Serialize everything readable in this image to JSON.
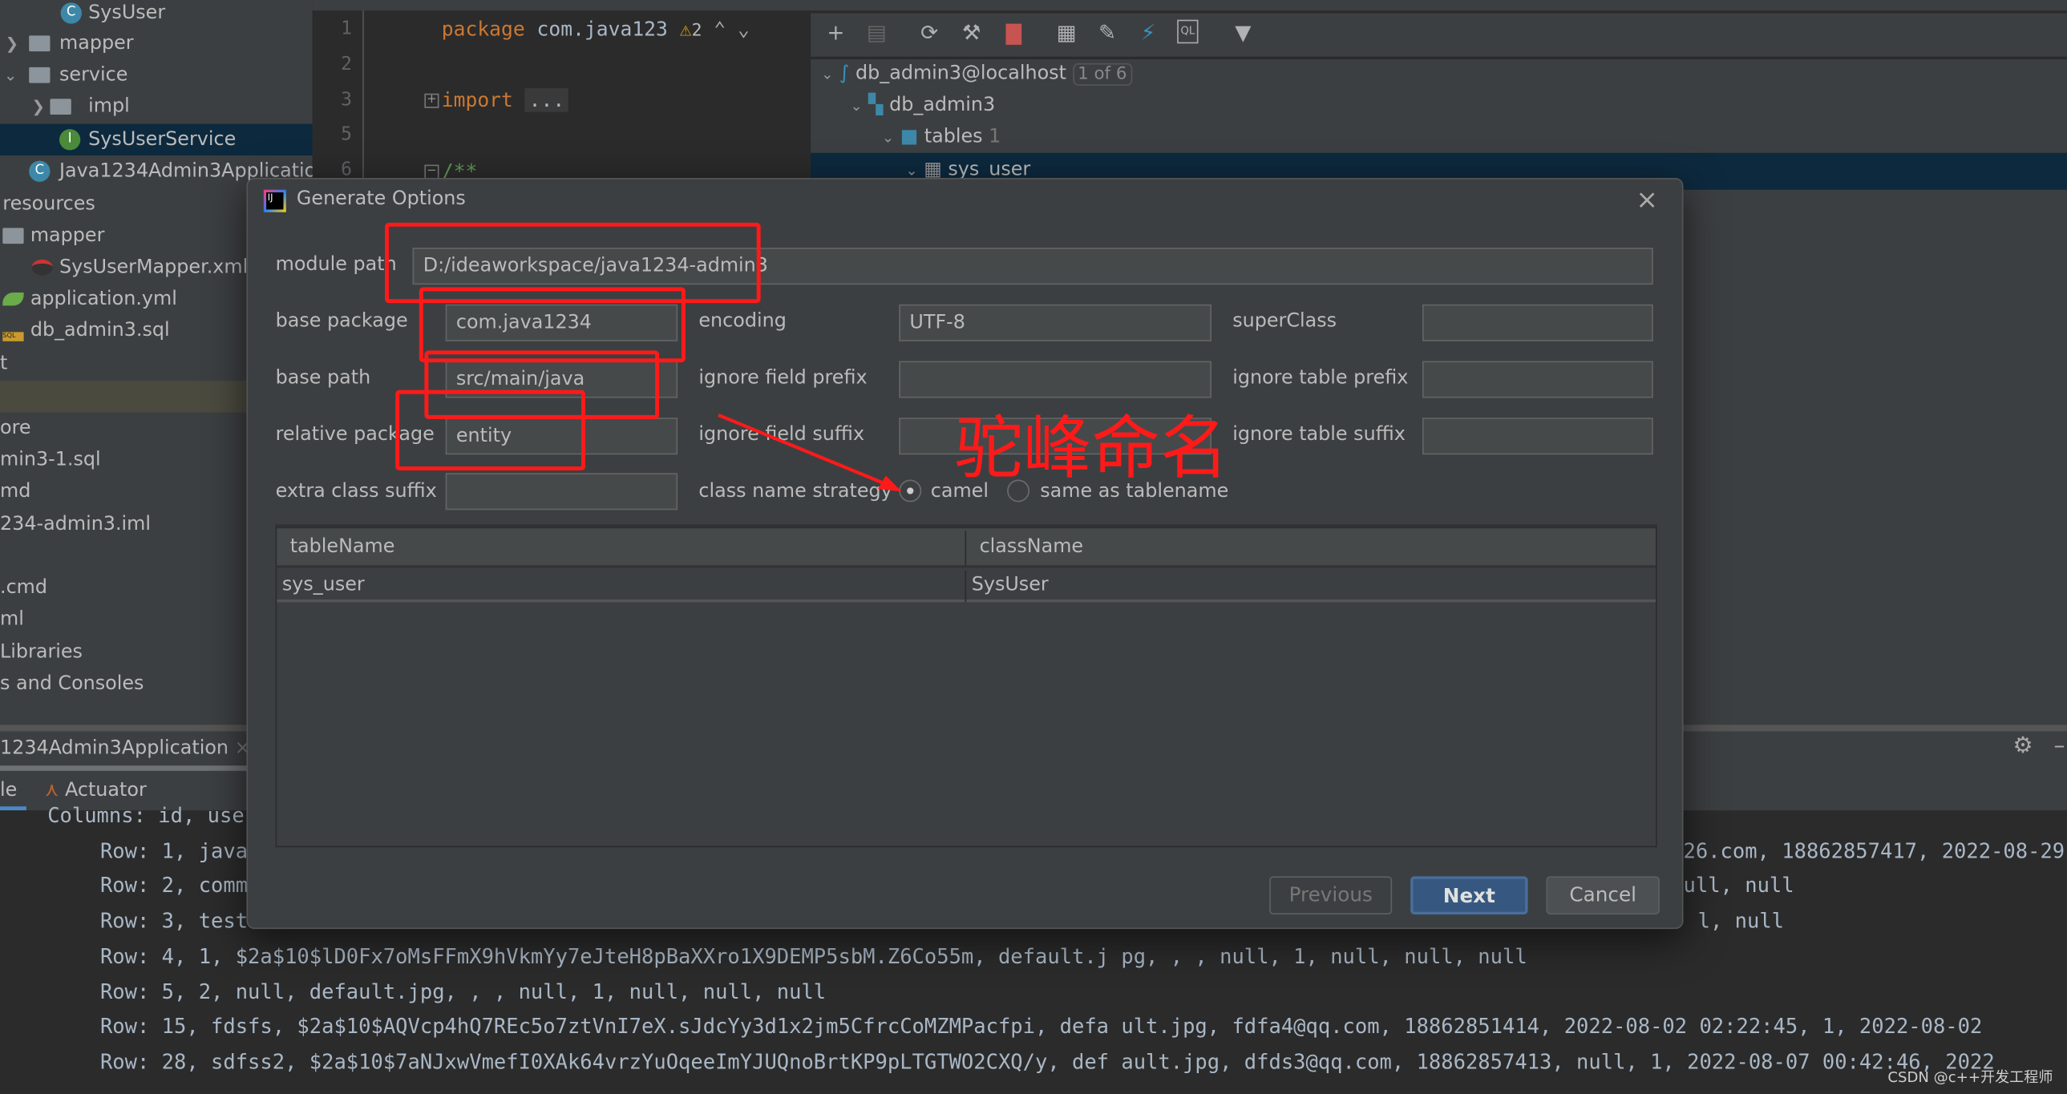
{
  "project_tree": {
    "items": [
      {
        "label": "SysUser",
        "icon": "class-icon"
      },
      {
        "label": "mapper",
        "icon": "package-icon"
      },
      {
        "label": "service",
        "icon": "package-icon"
      },
      {
        "label": "impl",
        "icon": "package-icon"
      },
      {
        "label": "SysUserService",
        "icon": "interface-icon"
      },
      {
        "label": "Java1234Admin3Application",
        "icon": "spring-boot-class-icon"
      },
      {
        "label": "resources",
        "icon": "folder-icon"
      },
      {
        "label": "mapper",
        "icon": "folder-icon"
      },
      {
        "label": "SysUserMapper.xml",
        "icon": "mybatis-icon"
      },
      {
        "label": "application.yml",
        "icon": "spring-config-icon"
      },
      {
        "label": "db_admin3.sql",
        "icon": "sql-icon"
      },
      {
        "label": "t"
      },
      {
        "label": ""
      },
      {
        "label": "ore"
      },
      {
        "label": "min3-1.sql"
      },
      {
        "label": "md"
      },
      {
        "label": "234-admin3.iml"
      },
      {
        "label": ""
      },
      {
        "label": ".cmd"
      },
      {
        "label": "ml"
      },
      {
        "label": "Libraries"
      },
      {
        "label": "s and Consoles"
      }
    ]
  },
  "editor": {
    "line_numbers": [
      "1",
      "2",
      "3",
      "5",
      "6"
    ],
    "line1_keyword": "package",
    "line1_text": "com.java123",
    "warning_count": "2",
    "line3_keyword": "import",
    "line3_folded": "...",
    "line6_text": "/**"
  },
  "database": {
    "connection": "db_admin3@localhost",
    "connection_badge": "1 of 6",
    "schema": "db_admin3",
    "tables_label": "tables",
    "tables_count": "1",
    "table": "sys_user"
  },
  "run_panel": {
    "run_tab": "1234Admin3Application",
    "tab_console": "le",
    "tab_actuator": "Actuator"
  },
  "console": {
    "lines": [
      "Columns: id, use",
      "Row: 1, java",
      "Row: 2, comm",
      "Row: 3, test",
      "Row: 4, 1, $2a$10$lD0Fx7oMsFFmX9hVkmYy7eJteH8pBaXXro1X9DEMP5sbM.Z6Co55m, default.j pg, , , null, 1, null, null, null",
      "Row: 5, 2, null, default.jpg, , , null, 1, null, null, null",
      "Row: 15, fdsfs, $2a$10$AQVcp4hQ7REc5o7ztVnI7eX.sJdcYy3d1x2jm5CfrcCoMZMPacfpi, defa ult.jpg, fdfa4@qq.com, 18862851414, 2022-08-02 02:22:45, 1, 2022-08-02",
      "Row: 28, sdfss2, $2a$10$7aNJxwVmefI0XAk64vrzYuOqeeImYJUQnoBrtKP9pLTGTWO2CXQ/y, def ault.jpg, dfds3@qq.com, 18862857413, null, 1, 2022-08-07 00:42:46, 2022"
    ],
    "row1_tail": "26.com, 18862857417, 2022-08-29",
    "row2_tail": "ull, null",
    "row3_tail": "l, null"
  },
  "dialog": {
    "title": "Generate Options",
    "module_path_label": "module path",
    "module_path": "D:/ideaworkspace/java1234-admin3",
    "base_package_label": "base package",
    "base_package": "com.java1234",
    "encoding_label": "encoding",
    "encoding": "UTF-8",
    "superclass_label": "superClass",
    "superclass": "",
    "base_path_label": "base path",
    "base_path": "src/main/java",
    "ignore_field_prefix_label": "ignore field prefix",
    "ignore_field_prefix": "",
    "ignore_table_prefix_label": "ignore table prefix",
    "ignore_table_prefix": "",
    "relative_package_label": "relative package",
    "relative_package": "entity",
    "ignore_field_suffix_label": "ignore field suffix",
    "ignore_field_suffix": "",
    "ignore_table_suffix_label": "ignore table suffix",
    "ignore_table_suffix": "",
    "extra_class_suffix_label": "extra class suffix",
    "extra_class_suffix": "",
    "class_name_strategy_label": "class name strategy",
    "strategy_options": [
      "camel",
      "same as tablename"
    ],
    "strategy_selected": "camel",
    "table_headers": [
      "tableName",
      "className"
    ],
    "table_rows": [
      [
        "sys_user",
        "SysUser"
      ]
    ],
    "previous": "Previous",
    "next": "Next",
    "cancel": "Cancel"
  },
  "annotation": {
    "text": "驼峰命名",
    "color": "#ff1a1a"
  },
  "watermark": "CSDN @c++开发工程师",
  "colors": {
    "selection": "#0d293e",
    "accent_button": "#365880",
    "panel": "#3c3f41",
    "editor": "#2b2b2b"
  }
}
